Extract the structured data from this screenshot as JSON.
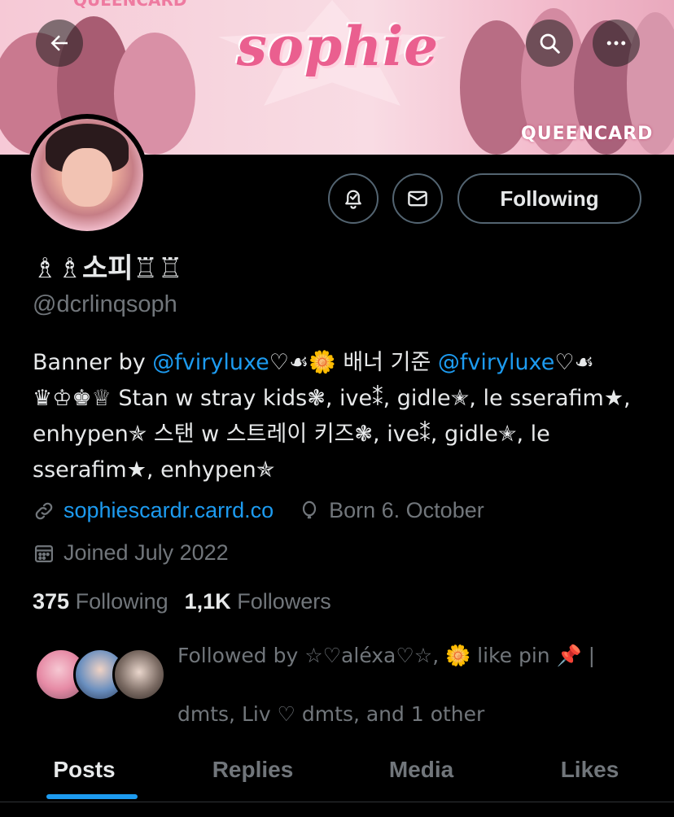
{
  "banner": {
    "title": "sophie",
    "tag_bottom": "QUEENCARD",
    "tag_top": "QUEENCARD"
  },
  "header": {
    "back_icon": "arrow-left-icon",
    "search_icon": "search-icon",
    "more_icon": "more-horizontal-icon"
  },
  "profile": {
    "display_name": "♗♗소피♖♖",
    "handle": "@dcrlinqsoph",
    "bio": {
      "prefix": "Banner by ",
      "mention1": "@fviryluxe",
      "middle": "♡☙🌼 배너 기준 ",
      "mention2": "@fviryluxe",
      "rest": "♡☙ ♛♔♚♕ Stan w stray kids❃, ive⁑, gidle✭, le sserafim★, enhypen✯ 스탠 w 스트레이 키즈❃, ive⁑, gidle✭, le sserafim★, enhypen✯"
    },
    "website": "sophiescardr.carrd.co",
    "birthday": "Born 6. October",
    "joined": "Joined July 2022",
    "following_count": "375",
    "following_label": "Following",
    "followers_count": "1,1K",
    "followers_label": "Followers",
    "followed_by": "Followed by ☆♡aléxa♡☆, 🌼 like pin 📌 | dmts, Liv ♡ dmts, and 1 other"
  },
  "actions": {
    "notify_icon": "bell-check-icon",
    "message_icon": "mail-icon",
    "following_label": "Following"
  },
  "tabs": [
    {
      "label": "Posts",
      "active": true
    },
    {
      "label": "Replies",
      "active": false
    },
    {
      "label": "Media",
      "active": false
    },
    {
      "label": "Likes",
      "active": false
    }
  ],
  "colors": {
    "accent": "#1d9bf0",
    "text_primary": "#e7e9ea",
    "text_secondary": "#71767b",
    "border": "#536471",
    "background": "#000000"
  }
}
